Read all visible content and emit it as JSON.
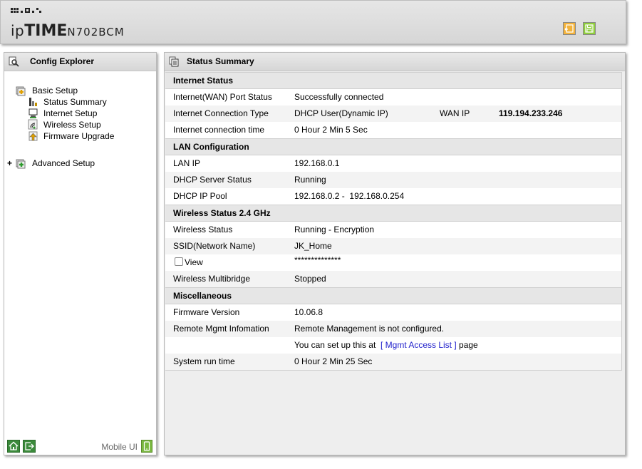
{
  "header": {
    "brand": "ipTIME",
    "brand_prefix": "ip",
    "brand_bold": "TIME",
    "model": "N702BCM",
    "buttons": [
      {
        "name": "restore",
        "icon": "restore-icon",
        "color": "#f3b23a"
      },
      {
        "name": "save",
        "icon": "save-icon",
        "color": "#8fce3c"
      }
    ]
  },
  "explorer": {
    "title": "Config Explorer",
    "tree": {
      "basic": {
        "label": "Basic Setup",
        "items": {
          "status_summary": "Status Summary",
          "internet_setup": "Internet Setup",
          "wireless_setup": "Wireless Setup",
          "firmware_upgrade": "Firmware Upgrade"
        }
      },
      "advanced": {
        "label": "Advanced Setup",
        "expander": "+"
      }
    },
    "footer": {
      "mobile_label": "Mobile UI"
    }
  },
  "status": {
    "title": "Status Summary",
    "internet": {
      "section": "Internet Status",
      "wan_port_label": "Internet(WAN) Port Status",
      "wan_port_value": "Successfully connected",
      "conn_type_label": "Internet Connection Type",
      "conn_type_value": "DHCP User(Dynamic IP)",
      "wan_ip_label": "WAN IP",
      "wan_ip_value": "119.194.233.246",
      "conn_time_label": "Internet connection time",
      "conn_time_value": "0 Hour 2 Min 5 Sec"
    },
    "lan": {
      "section": "LAN Configuration",
      "ip_label": "LAN IP",
      "ip_value": "192.168.0.1",
      "dhcp_label": "DHCP Server Status",
      "dhcp_value": "Running",
      "pool_label": "DHCP IP Pool",
      "pool_value": "192.168.0.2 -  192.168.0.254"
    },
    "wireless": {
      "section": "Wireless Status 2.4 GHz",
      "status_label": "Wireless Status",
      "status_value": "Running - Encryption",
      "ssid_label": "SSID(Network Name)",
      "ssid_value": "JK_Home",
      "view_label": "View",
      "view_checked": false,
      "password_value": "**************",
      "multibridge_label": "Wireless Multibridge",
      "multibridge_value": "Stopped"
    },
    "misc": {
      "section": "Miscellaneous",
      "fw_label": "Firmware Version",
      "fw_value": "10.06.8",
      "remote_label": "Remote Mgmt Infomation",
      "remote_value": "Remote Management is not configured.",
      "setup_prefix": "You can set up this at",
      "setup_link": "[ Mgmt Access List ]",
      "setup_suffix": "page",
      "runtime_label": "System run time",
      "runtime_value": "0 Hour 2 Min 25 Sec"
    }
  }
}
